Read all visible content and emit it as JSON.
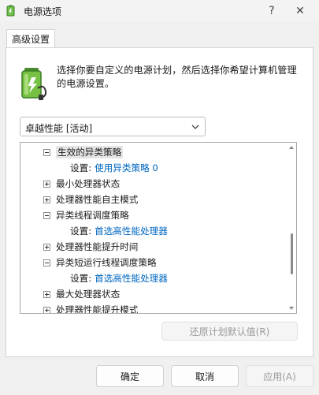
{
  "window": {
    "title": "电源选项",
    "help_glyph": "?",
    "close_glyph": "✕"
  },
  "tab": {
    "label": "高级设置"
  },
  "description": "选择你要自定义的电源计划，然后选择你希望计算机管理的电源设置。",
  "plan_select": {
    "value": "卓越性能 [活动]"
  },
  "tree": {
    "rows": [
      {
        "label": "生效的异类策略",
        "expanded": true,
        "selected": true
      },
      {
        "setting_label": "设置:",
        "setting_value": "使用异类策略 0"
      },
      {
        "label": "最小处理器状态",
        "expanded": false
      },
      {
        "label": "处理器性能自主模式",
        "expanded": false
      },
      {
        "label": "异类线程调度策略",
        "expanded": true
      },
      {
        "setting_label": "设置:",
        "setting_value": "首选高性能处理器"
      },
      {
        "label": "处理器性能提升时间",
        "expanded": false
      },
      {
        "label": "异类短运行线程调度策略",
        "expanded": true
      },
      {
        "setting_label": "设置:",
        "setting_value": "首选高性能处理器"
      },
      {
        "label": "最大处理器状态",
        "expanded": false
      },
      {
        "label": "处理器性能提升模式",
        "expanded": false
      }
    ]
  },
  "buttons": {
    "restore": "还原计划默认值(R)",
    "ok": "确定",
    "cancel": "取消",
    "apply": "应用(A)"
  },
  "colors": {
    "link": "#0067c0",
    "accent_green": "#3aa43a"
  }
}
